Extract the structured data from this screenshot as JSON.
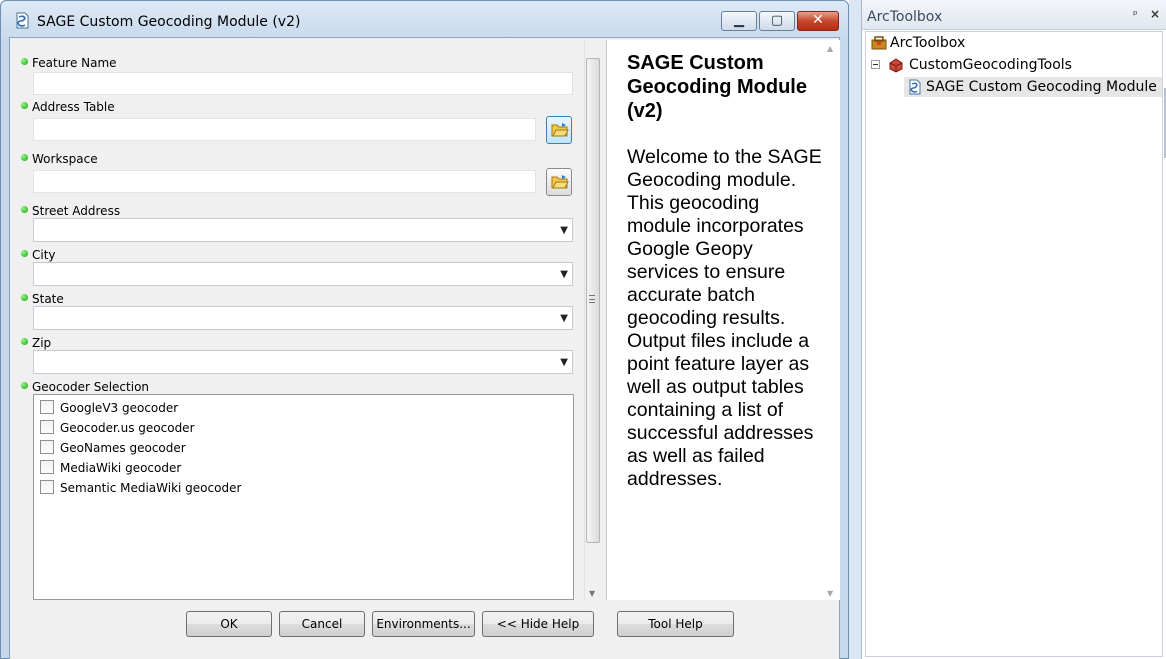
{
  "dialog": {
    "title": "SAGE Custom Geocoding Module (v2)",
    "window_buttons": {
      "minimize": "▁",
      "maximize": "▢",
      "close": "✕"
    }
  },
  "params": {
    "feature_name": {
      "label": "Feature Name",
      "value": ""
    },
    "address_table": {
      "label": "Address Table",
      "value": ""
    },
    "workspace": {
      "label": "Workspace",
      "value": ""
    },
    "street_address": {
      "label": "Street Address",
      "value": ""
    },
    "city": {
      "label": "City",
      "value": ""
    },
    "state": {
      "label": "State",
      "value": ""
    },
    "zip": {
      "label": "Zip",
      "value": ""
    },
    "geocoder_selection": {
      "label": "Geocoder Selection",
      "options": [
        {
          "label": "GoogleV3 geocoder",
          "checked": false
        },
        {
          "label": "Geocoder.us geocoder",
          "checked": false
        },
        {
          "label": "GeoNames geocoder",
          "checked": false
        },
        {
          "label": "MediaWiki geocoder",
          "checked": false
        },
        {
          "label": "Semantic MediaWiki geocoder",
          "checked": false
        }
      ]
    }
  },
  "help": {
    "title": "SAGE Custom Geocoding Module (v2)",
    "body": "Welcome to the SAGE Geocoding module. This geocoding module incorporates Google Geopy services to ensure accurate batch geocoding results. Output files include a point feature layer as well as output tables containing a list of successful addresses as well as failed addresses."
  },
  "buttons": {
    "ok": "OK",
    "cancel": "Cancel",
    "environments": "Environments...",
    "hide_help": "<< Hide Help",
    "tool_help": "Tool Help"
  },
  "toolbox": {
    "title": "ArcToolbox",
    "pin": "ᵖ",
    "close": "×",
    "tree": {
      "root": "ArcToolbox",
      "toolset": "CustomGeocodingTools",
      "tool": "SAGE Custom Geocoding Module (v"
    }
  },
  "colors": {
    "required_dot": "#22b022",
    "title_bar": "#c9dbee",
    "selected_row": "#e6e6e6"
  }
}
